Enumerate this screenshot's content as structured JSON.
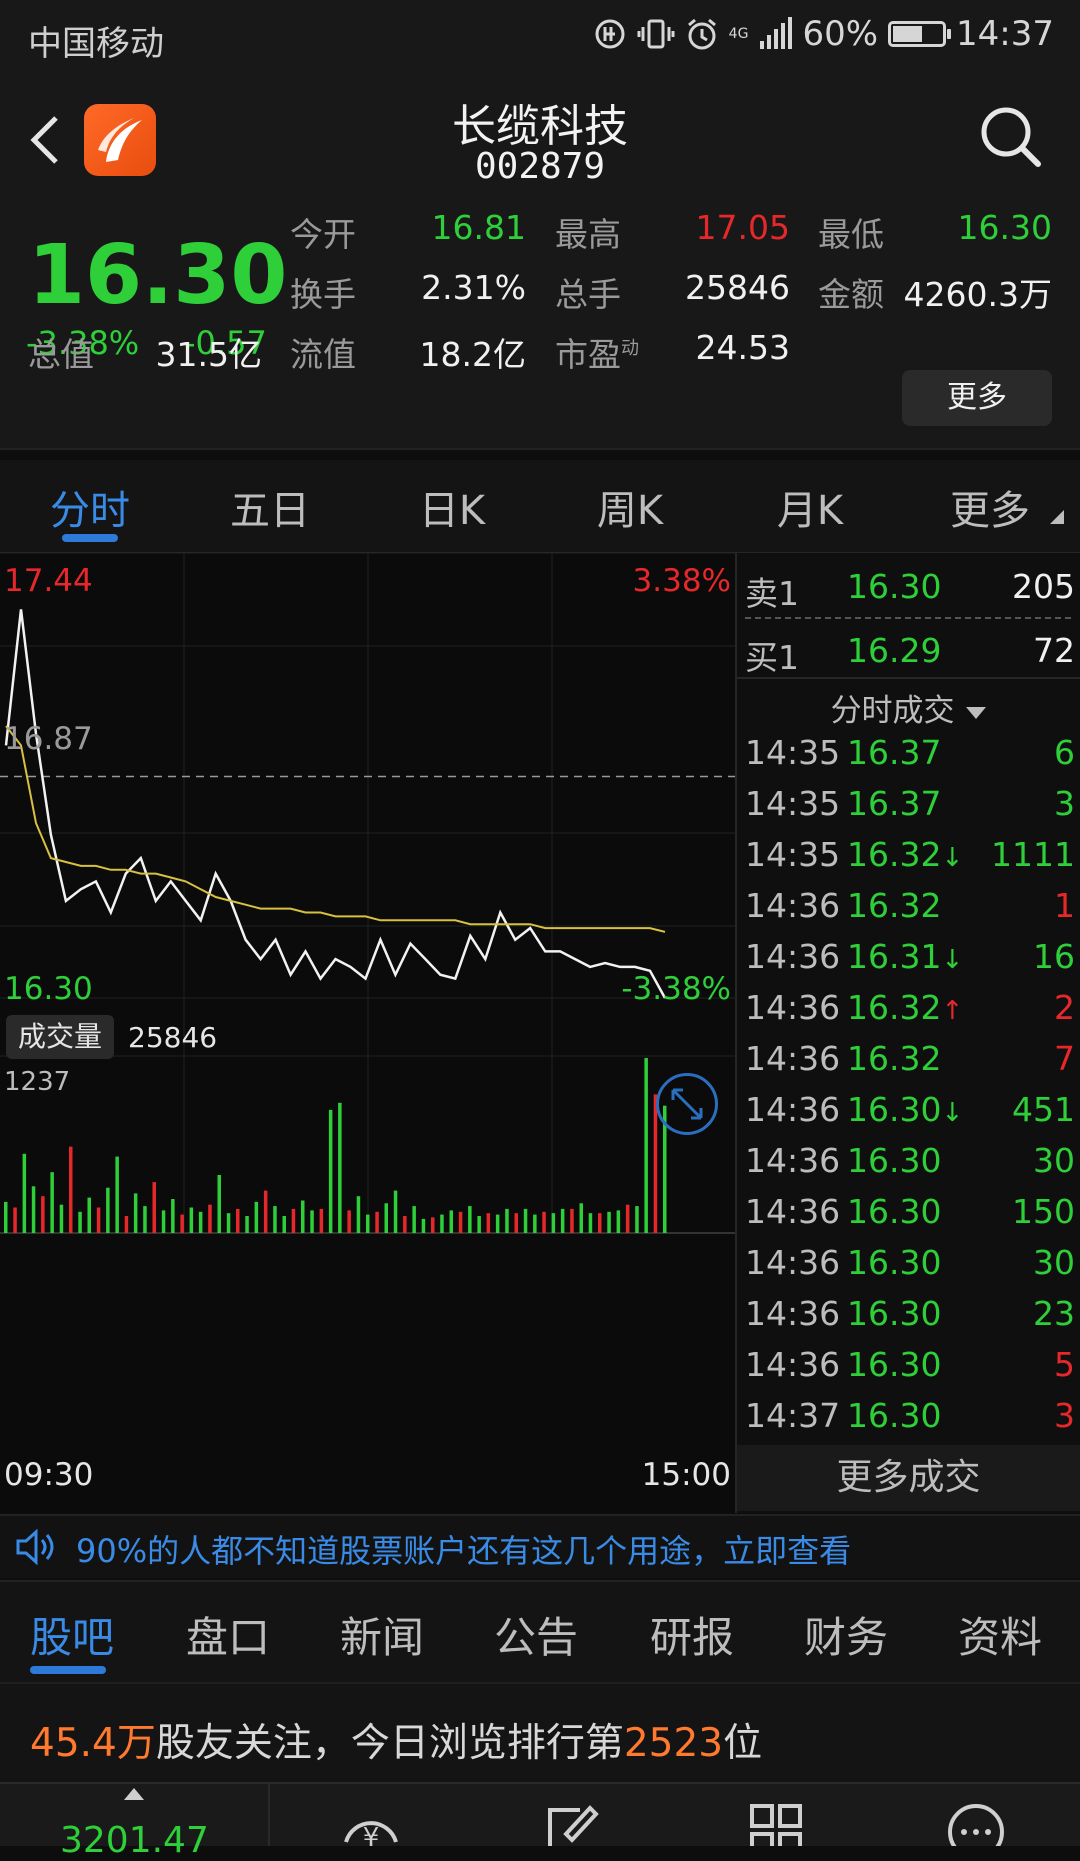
{
  "status_bar": {
    "carrier": "中国移动",
    "signal_type": "4G",
    "battery": "60%",
    "time": "14:37"
  },
  "header": {
    "name": "长缆科技",
    "code": "002879"
  },
  "quote": {
    "price": "16.30",
    "change_pct": "-3.38%",
    "change": "-0.57",
    "fields": [
      {
        "label": "今开",
        "value": "16.81",
        "color": "green"
      },
      {
        "label": "最高",
        "value": "17.05",
        "color": "red"
      },
      {
        "label": "最低",
        "value": "16.30",
        "color": "green"
      },
      {
        "label": "换手",
        "value": "2.31%",
        "color": "white"
      },
      {
        "label": "总手",
        "value": "25846",
        "color": "white"
      },
      {
        "label": "金额",
        "value": "4260.3万",
        "color": "white"
      },
      {
        "label": "总值",
        "value": "31.5亿",
        "color": "white"
      },
      {
        "label": "流值",
        "value": "18.2亿",
        "color": "white"
      },
      {
        "label": "市盈",
        "value": "24.53",
        "color": "white"
      }
    ],
    "pe_superscript": "动",
    "more_label": "更多"
  },
  "tabs": [
    "分时",
    "五日",
    "日K",
    "周K",
    "月K",
    "更多"
  ],
  "chart": {
    "high": "17.44",
    "high_pct": "3.38%",
    "prev_close": "16.87",
    "low": "16.30",
    "low_pct": "-3.38%",
    "volume_label": "成交量",
    "volume_value": "25846",
    "volume_max": "1237",
    "start_time": "09:30",
    "end_time": "15:00"
  },
  "chart_data": {
    "type": "line",
    "series": [
      {
        "values": [
          16.95,
          17.3,
          16.98,
          16.72,
          16.55,
          16.58,
          16.6,
          16.52,
          16.62,
          16.66,
          16.55,
          16.6,
          16.55,
          16.5,
          16.62,
          16.55,
          16.45,
          16.4,
          16.45,
          16.36,
          16.42,
          16.35,
          16.4,
          16.38,
          16.35,
          16.45,
          16.36,
          16.44,
          16.4,
          16.36,
          16.35,
          16.46,
          16.4,
          16.52,
          16.45,
          16.48,
          16.42,
          16.42,
          16.4,
          16.38,
          16.39,
          16.38,
          16.38,
          16.37,
          16.3
        ]
      },
      {
        "values": [
          17.0,
          16.95,
          16.75,
          16.66,
          16.65,
          16.64,
          16.64,
          16.63,
          16.63,
          16.62,
          16.62,
          16.61,
          16.6,
          16.58,
          16.56,
          16.55,
          16.54,
          16.53,
          16.53,
          16.53,
          16.52,
          16.52,
          16.51,
          16.51,
          16.51,
          16.5,
          16.5,
          16.5,
          16.5,
          16.5,
          16.5,
          16.49,
          16.49,
          16.49,
          16.49,
          16.49,
          16.48,
          16.48,
          16.48,
          16.48,
          16.48,
          16.48,
          16.48,
          16.48,
          16.47
        ]
      }
    ],
    "ylim": [
      16.3,
      17.44
    ],
    "volume": [
      220,
      180,
      560,
      330,
      260,
      430,
      200,
      610,
      150,
      250,
      180,
      320,
      540,
      120,
      280,
      190,
      360,
      160,
      240,
      130,
      180,
      150,
      200,
      410,
      140,
      170,
      120,
      220,
      300,
      190,
      120,
      170,
      230,
      160,
      170,
      870,
      920,
      160,
      260,
      130,
      150,
      210,
      300,
      120,
      190,
      100,
      110,
      130,
      160,
      150,
      190,
      120,
      140,
      130,
      170,
      140,
      170,
      130,
      150,
      140,
      170,
      170,
      210,
      140,
      140,
      150,
      160,
      200,
      190,
      1237,
      980,
      900
    ]
  },
  "order_book": [
    {
      "label": "卖1",
      "price": "16.30",
      "volume": "205"
    },
    {
      "label": "买1",
      "price": "16.29",
      "volume": "72"
    }
  ],
  "trade_header": "分时成交",
  "trades": [
    {
      "time": "14:35",
      "price": "16.37",
      "arrow": "",
      "volume": "6",
      "color": "green"
    },
    {
      "time": "14:35",
      "price": "16.37",
      "arrow": "",
      "volume": "3",
      "color": "green"
    },
    {
      "time": "14:35",
      "price": "16.32",
      "arrow": "↓",
      "volume": "1111",
      "color": "green"
    },
    {
      "time": "14:36",
      "price": "16.32",
      "arrow": "",
      "volume": "1",
      "color": "red"
    },
    {
      "time": "14:36",
      "price": "16.31",
      "arrow": "↓",
      "volume": "16",
      "color": "green"
    },
    {
      "time": "14:36",
      "price": "16.32",
      "arrow": "↑",
      "volume": "2",
      "color": "red"
    },
    {
      "time": "14:36",
      "price": "16.32",
      "arrow": "",
      "volume": "7",
      "color": "red"
    },
    {
      "time": "14:36",
      "price": "16.30",
      "arrow": "↓",
      "volume": "451",
      "color": "green"
    },
    {
      "time": "14:36",
      "price": "16.30",
      "arrow": "",
      "volume": "30",
      "color": "green"
    },
    {
      "time": "14:36",
      "price": "16.30",
      "arrow": "",
      "volume": "150",
      "color": "green"
    },
    {
      "time": "14:36",
      "price": "16.30",
      "arrow": "",
      "volume": "30",
      "color": "green"
    },
    {
      "time": "14:36",
      "price": "16.30",
      "arrow": "",
      "volume": "23",
      "color": "green"
    },
    {
      "time": "14:36",
      "price": "16.30",
      "arrow": "",
      "volume": "5",
      "color": "red"
    },
    {
      "time": "14:37",
      "price": "16.30",
      "arrow": "",
      "volume": "3",
      "color": "red"
    }
  ],
  "more_trades": "更多成交",
  "banner": {
    "text": "90%的人都不知道股票账户还有这几个用途，立即查看"
  },
  "bottom_tabs": [
    "股吧",
    "盘口",
    "新闻",
    "公告",
    "研报",
    "财务",
    "资料"
  ],
  "follow": {
    "count": "45.4万",
    "text_a": "股友关注，今日浏览排行第",
    "rank": "2523",
    "text_b": "位"
  },
  "navbar": {
    "index_value": "3201.47"
  },
  "colors": {
    "up": "#e7282a",
    "down": "#2fcf3a",
    "accent": "#3a8be6",
    "avg_line": "#d8c040"
  }
}
